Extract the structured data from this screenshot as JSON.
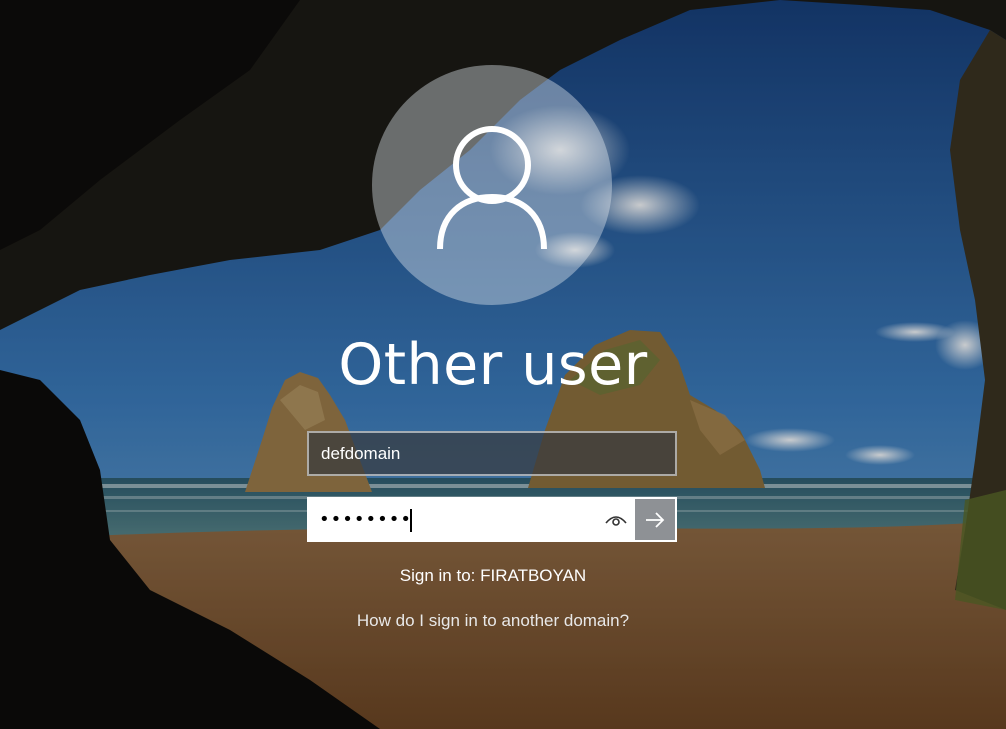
{
  "login": {
    "account_name": "Other user",
    "username_value": "defdomain",
    "password_mask": "••••••••",
    "sign_in_to": "Sign in to: FIRATBOYAN",
    "other_domain_link": "How do I sign in to another domain?"
  },
  "icons": {
    "avatar": "user-silhouette-icon",
    "reveal": "eye-icon",
    "submit": "arrow-right-icon"
  },
  "colors": {
    "sky": "#2f6fae",
    "sea": "#3c6f86",
    "sand": "#9a6a3c",
    "rock": "#8a6a3a",
    "cave": "#1a1712"
  }
}
